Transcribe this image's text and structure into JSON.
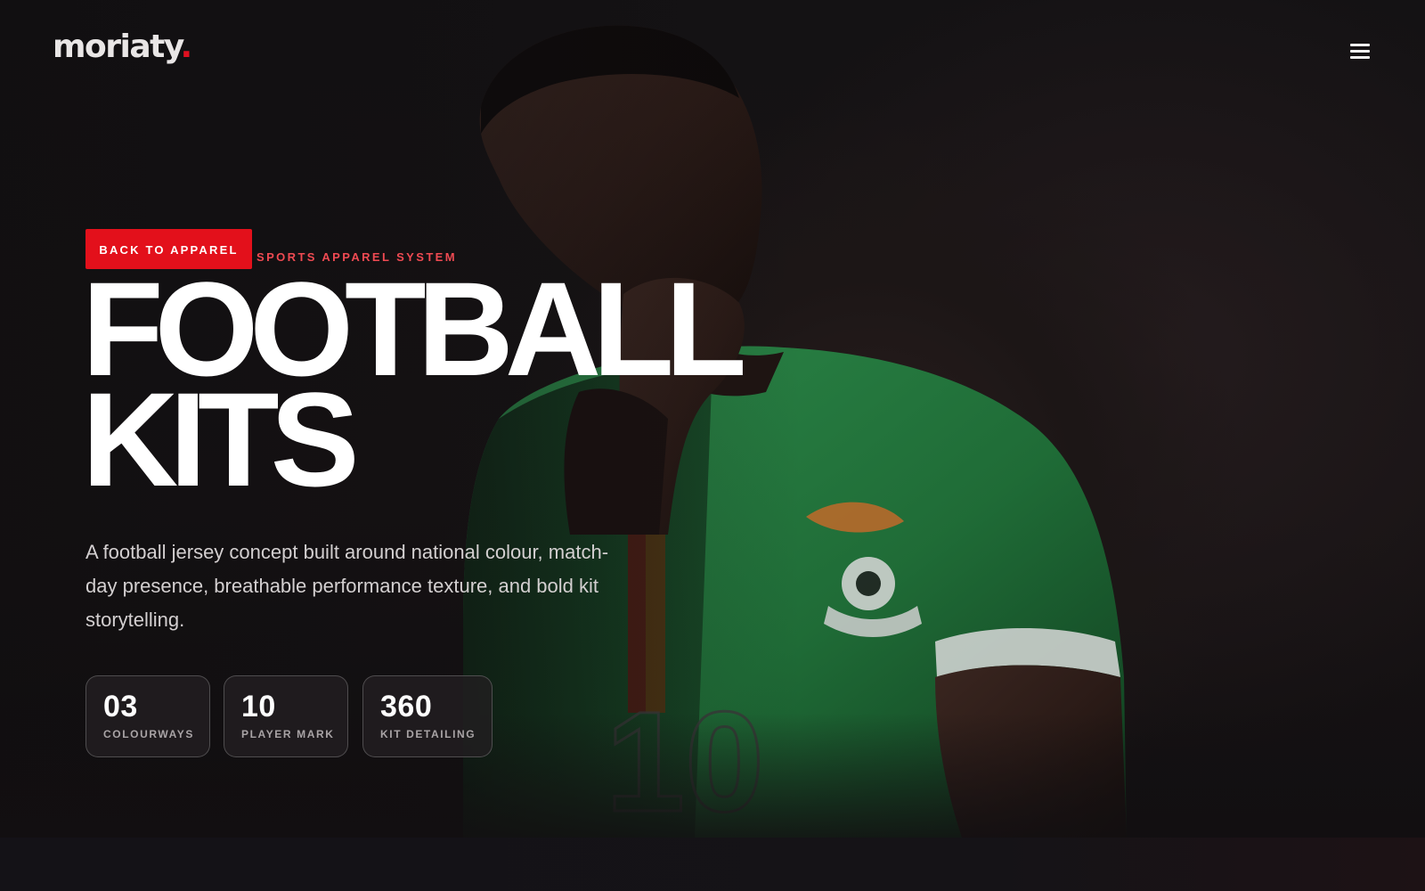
{
  "brand": {
    "logo_text": "moriaty",
    "logo_dot": ".",
    "accent_color": "#e3101b"
  },
  "nav": {
    "menu_icon": "hamburger-menu-icon"
  },
  "hero": {
    "back_button_label": "BACK TO APPAREL",
    "eyebrow": "SPORTS APPAREL SYSTEM",
    "headline_line1": "FOOTBALL",
    "headline_line2": "KITS",
    "description": "A football jersey concept built around national colour, match-day presence, breathable performance texture, and bold kit storytelling.",
    "stats": [
      {
        "value": "03",
        "label": "COLOURWAYS"
      },
      {
        "value": "10",
        "label": "PLAYER MARK"
      },
      {
        "value": "360",
        "label": "KIT DETAILING"
      }
    ],
    "image": {
      "subject": "footballer-in-green-jersey",
      "jersey_number": "10",
      "jersey_color": "#1f7a3a"
    }
  }
}
